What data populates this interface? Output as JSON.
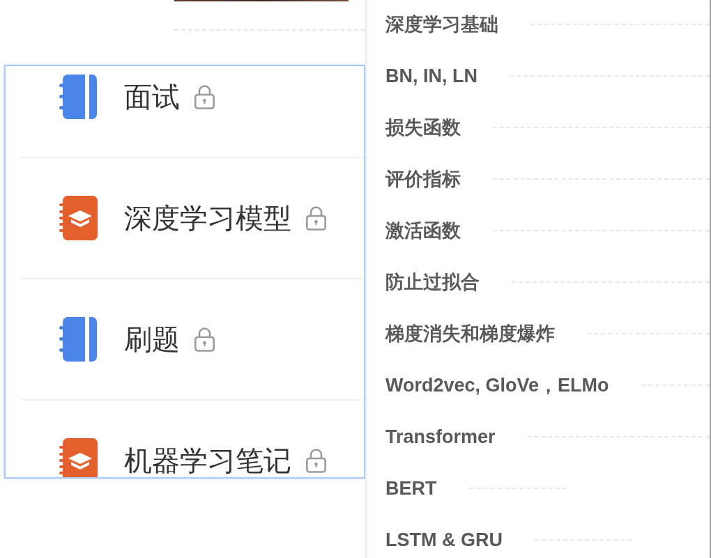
{
  "notebooks": {
    "items": [
      {
        "title": "面试",
        "kind": "plain",
        "color": "#4a86e8",
        "locked": true
      },
      {
        "title": "深度学习模型",
        "kind": "cap",
        "color": "#e35f2c",
        "locked": true
      },
      {
        "title": "刷题",
        "kind": "plain",
        "color": "#4a86e8",
        "locked": true
      },
      {
        "title": "机器学习笔记",
        "kind": "cap",
        "color": "#e35f2c",
        "locked": true
      }
    ]
  },
  "outline": {
    "items": [
      {
        "title": "深度学习基础",
        "short_leader": false
      },
      {
        "title": "BN, IN, LN",
        "short_leader": false
      },
      {
        "title": "损失函数",
        "short_leader": false
      },
      {
        "title": "评价指标",
        "short_leader": false
      },
      {
        "title": "激活函数",
        "short_leader": false
      },
      {
        "title": "防止过拟合",
        "short_leader": false
      },
      {
        "title": "梯度消失和梯度爆炸",
        "short_leader": false
      },
      {
        "title": "Word2vec, GloVe，ELMo",
        "short_leader": false
      },
      {
        "title": "Transformer",
        "short_leader": false
      },
      {
        "title": "BERT",
        "short_leader": true
      },
      {
        "title": "LSTM & GRU",
        "short_leader": true
      }
    ]
  }
}
